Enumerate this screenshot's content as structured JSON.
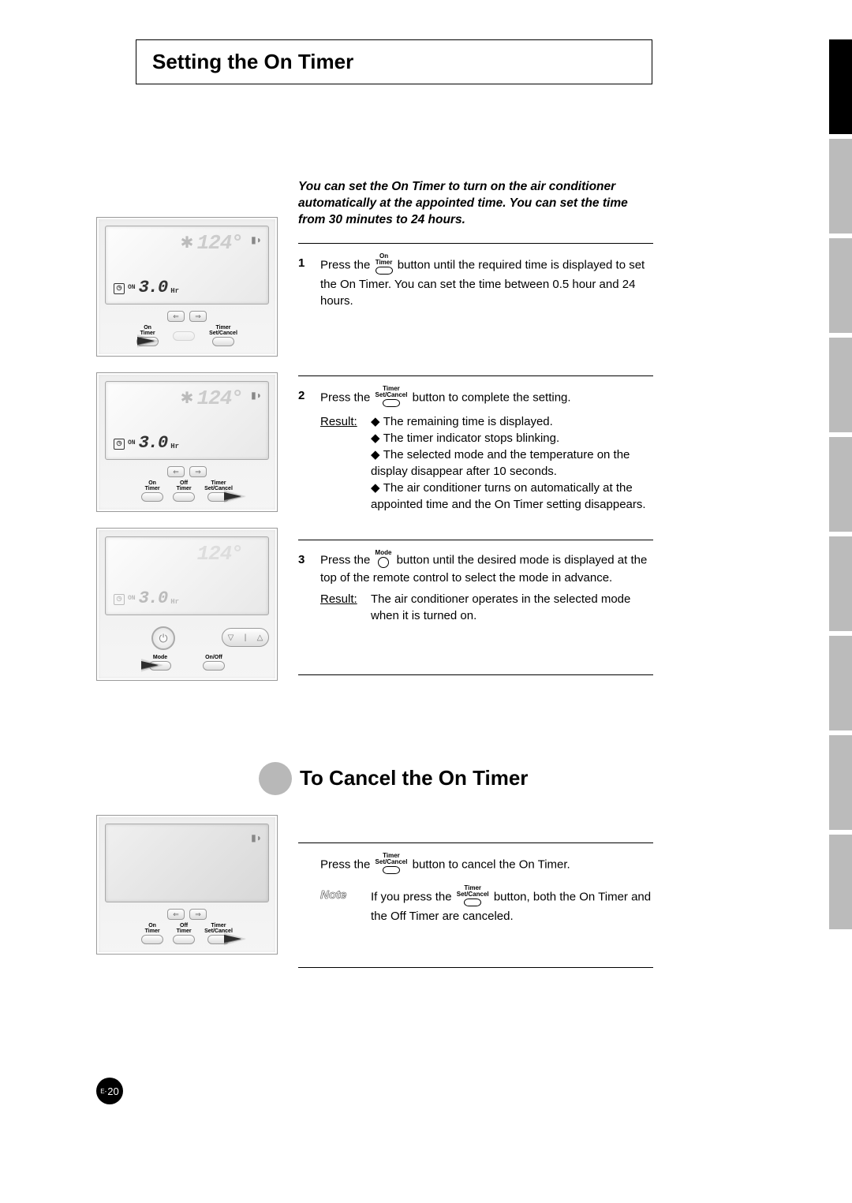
{
  "title": "Setting the On Timer",
  "intro": "You can set the On Timer to turn on the air conditioner automatically at the appointed time. You can set the time from 30 minutes to 24 hours.",
  "buttons": {
    "on_timer": "On\nTimer",
    "timer_set_cancel": "Timer\nSet/Cancel",
    "mode": "Mode"
  },
  "steps": [
    {
      "num": "1",
      "pre": "Press the ",
      "btn": "on_timer",
      "post": " button until the required time is displayed to set the On Timer. You can set the time between 0.5 hour and 24 hours."
    },
    {
      "num": "2",
      "pre": "Press the ",
      "btn": "timer_set_cancel",
      "post": " button to complete the setting.",
      "result_label": "Result:",
      "results": [
        "The remaining time is displayed.",
        "The timer indicator stops blinking.",
        "The selected mode and the temperature on the display disappear after 10 seconds.",
        "The air conditioner turns on automatically at the appointed time and the On Timer setting disappears."
      ]
    },
    {
      "num": "3",
      "pre": "Press the ",
      "btn": "mode",
      "post": " button until the desired mode is displayed at the top of the remote control to select the mode in advance.",
      "result_label": "Result:",
      "result_text": "The air conditioner operates in the selected mode when it is turned on."
    }
  ],
  "sub_heading": "To Cancel the On Timer",
  "cancel": {
    "pre": "Press the ",
    "btn": "timer_set_cancel",
    "post": " button to cancel the On Timer.",
    "note_label": "Note",
    "note_pre": "If you press the ",
    "note_btn": "timer_set_cancel",
    "note_post": " button, both the On Timer and the Off Timer are canceled."
  },
  "remote": {
    "temp": "124°",
    "timer_on_label": "ON",
    "timer_value": "3.0",
    "timer_unit": "Hr",
    "btn_on_timer": "On\nTimer",
    "btn_off_timer": "Off\nTimer",
    "btn_set_cancel": "Timer\nSet/Cancel",
    "btn_mode": "Mode",
    "btn_onoff": "On/Off"
  },
  "page": {
    "prefix": "E-",
    "num": "20"
  }
}
